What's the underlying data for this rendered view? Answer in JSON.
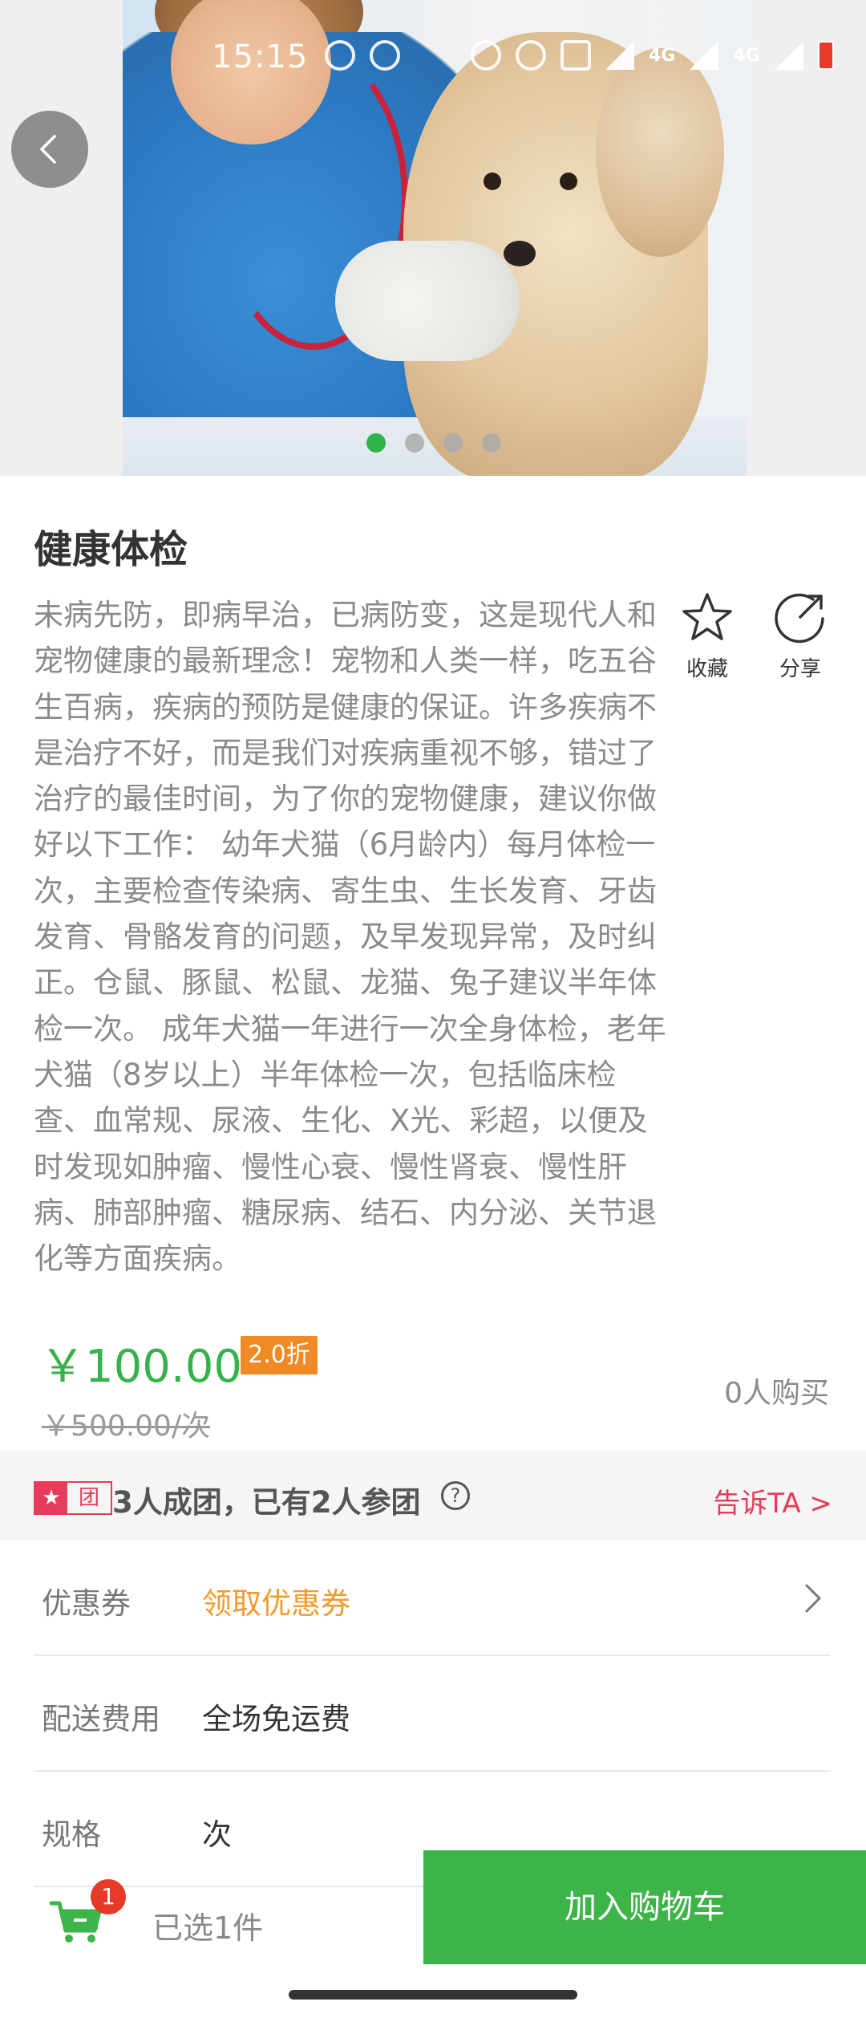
{
  "status_bar": {
    "time": "15:15",
    "network_1": "4G",
    "network_2": "4G"
  },
  "gallery": {
    "image_count": 4,
    "active_index": 0
  },
  "product": {
    "title": "健康体检",
    "description": "未病先防，即病早治，已病防变，这是现代人和宠物健康的最新理念！宠物和人类一样，吃五谷生百病，疾病的预防是健康的保证。许多疾病不是治疗不好，而是我们对疾病重视不够，错过了治疗的最佳时间，为了你的宠物健康，建议你做好以下工作： 幼年犬猫（6月龄内）每月体检一次，主要检查传染病、寄生虫、生长发育、牙齿发育、骨骼发育的问题，及早发现异常，及时纠正。仓鼠、豚鼠、松鼠、龙猫、兔子建议半年体检一次。 成年犬猫一年进行一次全身体检，老年犬猫（8岁以上）半年体检一次，包括临床检查、血常规、尿液、生化、X光、彩超，以便及时发现如肿瘤、慢性心衰、慢性肾衰、慢性肝病、肺部肿瘤、糖尿病、结石、内分泌、关节退化等方面疾病。",
    "price": "￥100.00",
    "discount": "2.0折",
    "original_price": "￥500.00/次",
    "buyers": "0人购买"
  },
  "actions": {
    "favorite_label": "收藏",
    "share_label": "分享"
  },
  "group_buy": {
    "badge_text": "团",
    "text": "3人成团，已有2人参团",
    "help": "?",
    "tell_label": "告诉TA >"
  },
  "rows": {
    "coupon_label": "优惠券",
    "coupon_value": "领取优惠券",
    "delivery_label": "配送费用",
    "delivery_value": "全场免运费",
    "spec_label": "规格",
    "spec_value": "次"
  },
  "bottom": {
    "cart_count": "1",
    "selected": "已选1件",
    "add_to_cart": "加入购物车"
  },
  "colors": {
    "accent_green": "#3cb448",
    "price_green": "#36b24a",
    "discount_orange": "#f08a24",
    "coupon_orange": "#f19b2c",
    "group_red": "#e83a5a"
  }
}
